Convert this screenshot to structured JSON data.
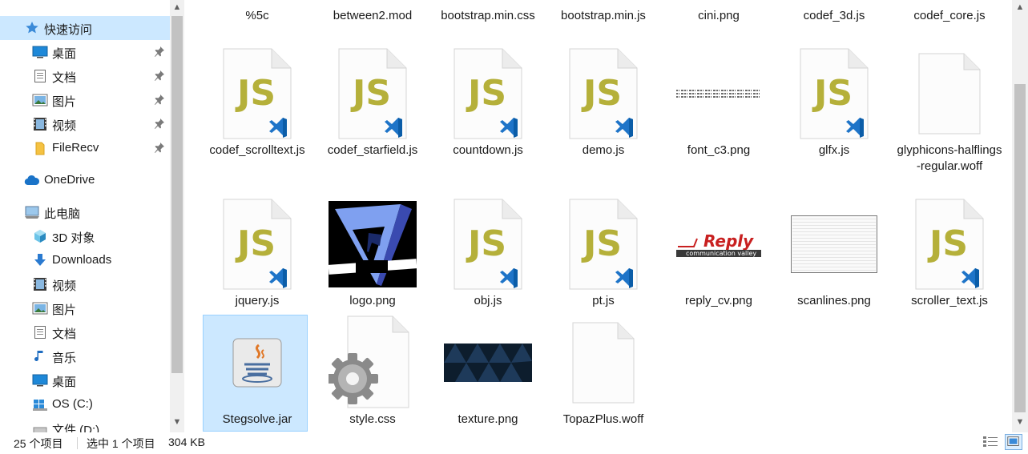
{
  "nav": {
    "items": [
      {
        "label": "快速访问",
        "icon": "star-icon",
        "selected": true
      },
      {
        "label": "桌面",
        "icon": "desktop-icon",
        "pinned": true
      },
      {
        "label": "文档",
        "icon": "documents-icon",
        "pinned": true
      },
      {
        "label": "图片",
        "icon": "pictures-icon",
        "pinned": true
      },
      {
        "label": "视频",
        "icon": "videos-icon",
        "pinned": true
      },
      {
        "label": "FileRecv",
        "icon": "folder-icon",
        "pinned": true
      },
      {
        "label": "OneDrive",
        "icon": "cloud-icon"
      },
      {
        "label": "此电脑",
        "icon": "computer-icon"
      },
      {
        "label": "3D 对象",
        "icon": "3d-objects-icon"
      },
      {
        "label": "Downloads",
        "icon": "downloads-icon"
      },
      {
        "label": "视频",
        "icon": "videos-icon"
      },
      {
        "label": "图片",
        "icon": "pictures-icon"
      },
      {
        "label": "文档",
        "icon": "documents-icon"
      },
      {
        "label": "音乐",
        "icon": "music-icon"
      },
      {
        "label": "桌面",
        "icon": "desktop-icon"
      },
      {
        "label": "OS (C:)",
        "icon": "os-drive-icon"
      },
      {
        "label": "文件 (D:)",
        "icon": "drive-icon"
      }
    ]
  },
  "files": {
    "row0": [
      {
        "name": "%5c",
        "type": "generic"
      },
      {
        "name": "between2.mod",
        "type": "generic"
      },
      {
        "name": "bootstrap.min.css",
        "type": "css"
      },
      {
        "name": "bootstrap.min.js",
        "type": "js"
      },
      {
        "name": "cini.png",
        "type": "image"
      },
      {
        "name": "codef_3d.js",
        "type": "js"
      },
      {
        "name": "codef_core.js",
        "type": "js"
      }
    ],
    "row1": [
      {
        "name": "codef_scrolltext.js",
        "type": "js"
      },
      {
        "name": "codef_starfield.js",
        "type": "js"
      },
      {
        "name": "countdown.js",
        "type": "js"
      },
      {
        "name": "demo.js",
        "type": "js"
      },
      {
        "name": "font_c3.png",
        "type": "font-strip"
      },
      {
        "name": "glfx.js",
        "type": "js"
      },
      {
        "name": "glyphicons-halflings-regular.woff",
        "type": "blank"
      }
    ],
    "row2": [
      {
        "name": "jquery.js",
        "type": "js"
      },
      {
        "name": "logo.png",
        "type": "logo"
      },
      {
        "name": "obj.js",
        "type": "js"
      },
      {
        "name": "pt.js",
        "type": "js"
      },
      {
        "name": "reply_cv.png",
        "type": "reply"
      },
      {
        "name": "scanlines.png",
        "type": "scanlines"
      },
      {
        "name": "scroller_text.js",
        "type": "js"
      }
    ],
    "row3": [
      {
        "name": "Stegsolve.jar",
        "type": "jar",
        "selected": true
      },
      {
        "name": "style.css",
        "type": "css"
      },
      {
        "name": "texture.png",
        "type": "texture"
      },
      {
        "name": "TopazPlus.woff",
        "type": "blank"
      }
    ]
  },
  "thumbnail_text": {
    "js_badge": "JS",
    "reply_title": "Reply",
    "reply_subtitle": "communication valley"
  },
  "status": {
    "item_count": "25 个项目",
    "selection": "选中 1 个项目",
    "size": "304 KB"
  },
  "colors": {
    "selection_bg": "#cce8ff",
    "js_text": "#b5b03a",
    "vscode_blue": "#1e74c8"
  }
}
